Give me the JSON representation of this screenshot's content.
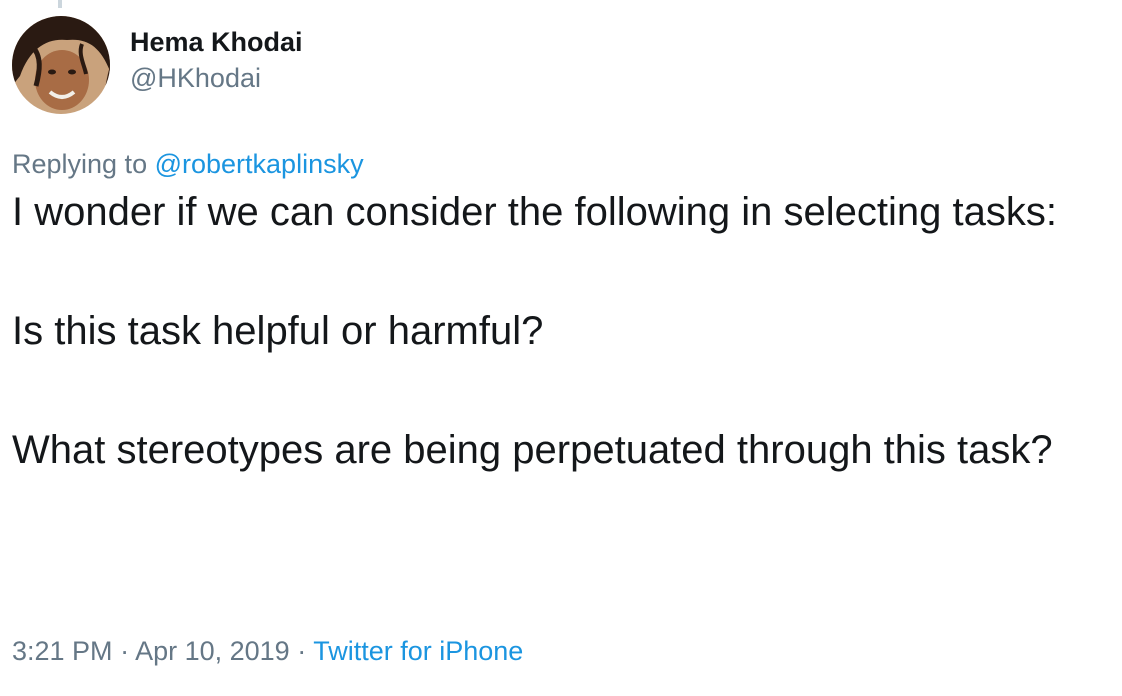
{
  "author": {
    "display_name": "Hema Khodai",
    "handle": "@HKhodai",
    "avatar_icon": "profile-photo"
  },
  "reply": {
    "prefix": "Replying to ",
    "mention": "@robertkaplinsky"
  },
  "tweet": {
    "paragraphs": [
      "I wonder if we can consider the following in selecting tasks:",
      "Is this task helpful or harmful?",
      "What stereotypes are being perpetuated through this task?"
    ]
  },
  "meta": {
    "time": "3:21 PM",
    "separator": " · ",
    "date": "Apr 10, 2019",
    "source": "Twitter for iPhone"
  },
  "colors": {
    "text": "#14171a",
    "secondary": "#657786",
    "link": "#1b95e0"
  }
}
